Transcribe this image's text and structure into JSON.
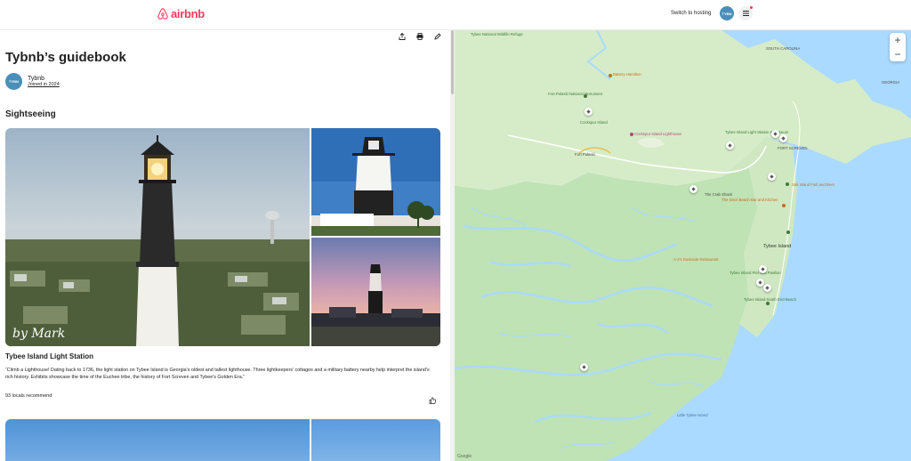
{
  "header": {
    "brand": "airbnb",
    "switch_hosting": "Switch to hosting",
    "avatar_initials": "TYBN"
  },
  "guide": {
    "title": "Tybnb’s guidebook",
    "author_name": "Tybnb",
    "author_joined": "Joined in 2024",
    "avatar_initials": "TYBN"
  },
  "section": {
    "title": "Sightseeing"
  },
  "place": {
    "title": "Tybee Island Light Station",
    "description": "“Climb a Lighthouse! Dating back to 1736, the light station on Tybee Island is Georgia's oldest and tallest lighthouse. Three lightkeepers' cottages and a military battery nearby help interpret the island's rich history. Exhibits showcase the time of the Euchee tribe, the history of Fort Screven and Tybee's Golden Era.”",
    "recommend": "93 locals recommend",
    "signature": "by Mark"
  },
  "map": {
    "labels": [
      "Battery Hamilton",
      "Fort Pulaski National Monument",
      "Cockspur Island",
      "Cockspur Island Lighthouse",
      "Fort Pulaski",
      "Tybee Island Light Station & Museum",
      "FORT SCREVEN",
      "Tybee National Wildlife Refuge",
      "SOUTH CAROLINA",
      "GEORGIA",
      "The Crab Shack",
      "The Deck Beach Bar and Kitchen",
      "Salt Island Fish and Beer",
      "A-J's Dockside Restaurant",
      "Tybee Island",
      "Tybee Island Pier and Pavilion",
      "Tybee Island South End Beach",
      "Little Tybee Island"
    ],
    "zoom_in": "+",
    "zoom_out": "−",
    "attribution": "Google"
  },
  "colors": {
    "brand": "#ff385c",
    "water": "#aadaff",
    "land": "#d6ecc8",
    "marsh": "#bfe3b4"
  }
}
